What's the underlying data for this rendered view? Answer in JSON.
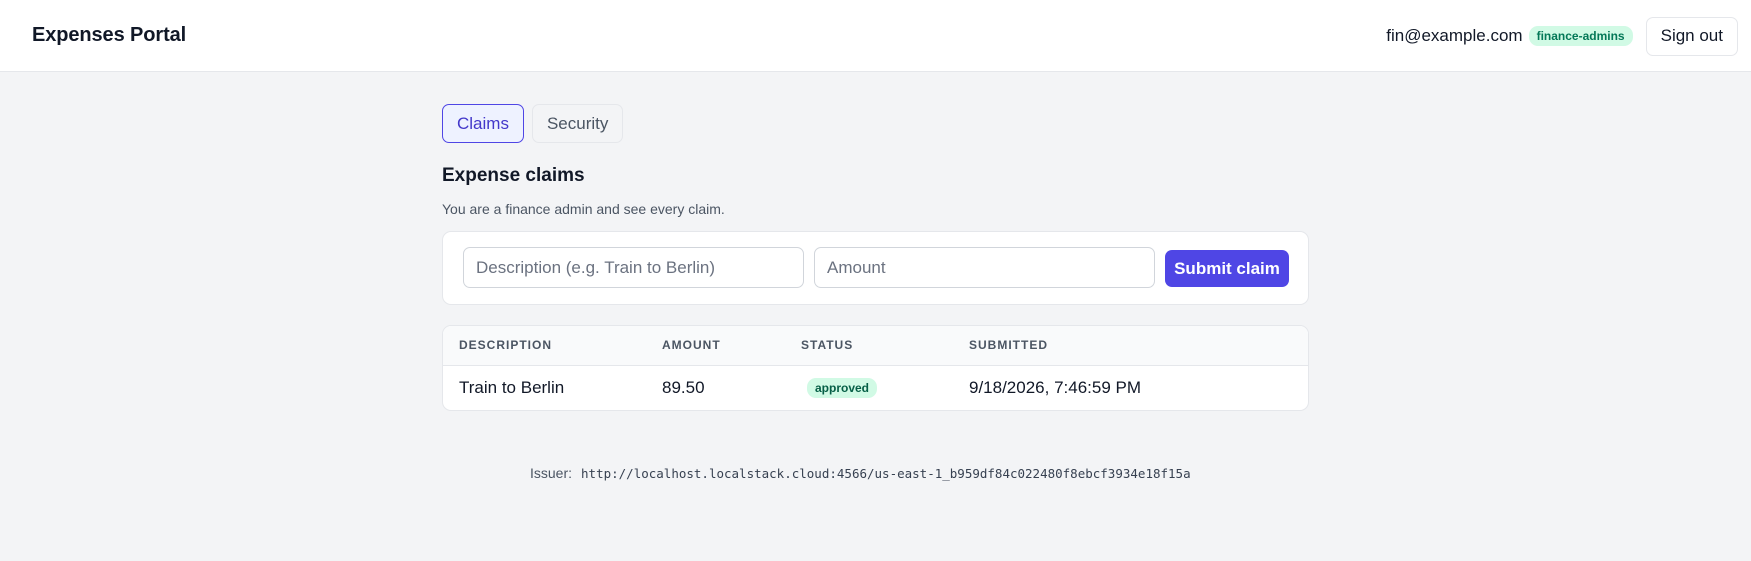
{
  "header": {
    "title": "Expenses Portal",
    "user_email": "fin@example.com",
    "group_badge": "finance-admins",
    "signout_label": "Sign out"
  },
  "tabs": [
    {
      "label": "Claims",
      "active": true
    },
    {
      "label": "Security",
      "active": false
    }
  ],
  "section": {
    "title": "Expense claims",
    "subtitle": "You are a finance admin and see every claim."
  },
  "form": {
    "description_placeholder": "Description (e.g. Train to Berlin)",
    "amount_placeholder": "Amount",
    "submit_label": "Submit claim"
  },
  "table": {
    "columns": [
      "DESCRIPTION",
      "AMOUNT",
      "STATUS",
      "SUBMITTED"
    ],
    "rows": [
      {
        "description": "Train to Berlin",
        "amount": "89.50",
        "status": "approved",
        "submitted": "9/18/2026, 7:46:59 PM"
      }
    ]
  },
  "footer": {
    "issuer_label": "Issuer:",
    "issuer_value": "http://localhost.localstack.cloud:4566/us-east-1_b959df84c022480f8ebcf3934e18f15a"
  },
  "colors": {
    "accent": "#4f46e5",
    "badge_bg": "#d1fae5",
    "badge_text": "#047857",
    "page_bg": "#f3f4f6"
  }
}
